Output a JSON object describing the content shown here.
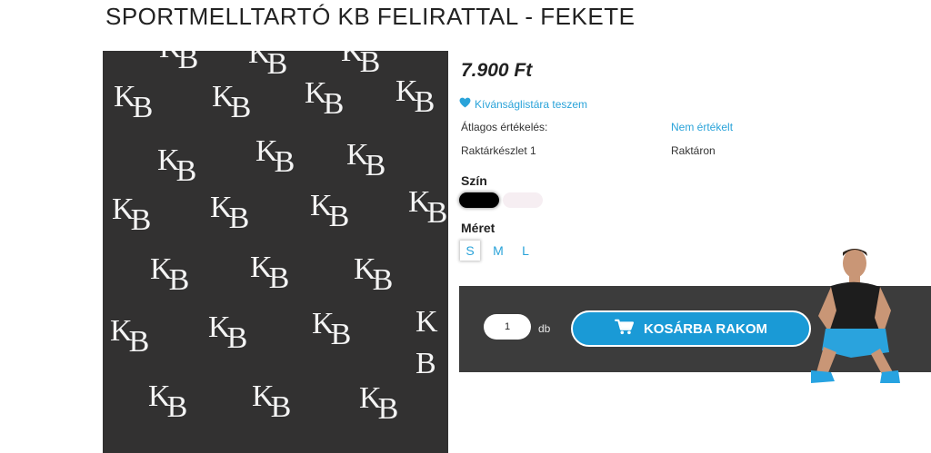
{
  "product": {
    "title": "SPORTMELLTARTÓ KB FELIRATTAL - FEKETE",
    "price": "7.900 Ft",
    "image_pattern_text": "KB"
  },
  "wishlist": {
    "icon": "heart-icon",
    "label": "Kívánságlistára teszem"
  },
  "info": {
    "rating_label": "Átlagos értékelés:",
    "rating_value": "Nem értékelt",
    "stock_label": "Raktárkészlet 1",
    "stock_value": "Raktáron"
  },
  "color": {
    "label": "Szín",
    "options": [
      {
        "name": "black",
        "hex": "#000000",
        "selected": true
      },
      {
        "name": "pink",
        "hex": "#f6eef2",
        "selected": false
      }
    ]
  },
  "size": {
    "label": "Méret",
    "options": [
      "S",
      "M",
      "L"
    ],
    "selected": "S"
  },
  "cart": {
    "quantity": "1",
    "unit": "db",
    "button_label": "KOSÁRBA RAKOM",
    "button_icon": "cart-icon"
  },
  "colors": {
    "accent": "#1a9ad6",
    "link": "#2aa3d9",
    "panel": "#3c3c3c",
    "image_bg": "#323131"
  }
}
